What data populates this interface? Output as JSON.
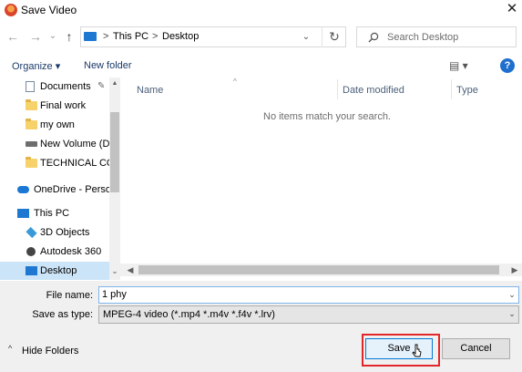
{
  "window": {
    "title": "Save Video",
    "close_glyph": "✕"
  },
  "nav_buttons": {
    "back_glyph": "←",
    "forward_glyph": "→",
    "dropdown_glyph": "⌄",
    "up_glyph": "↑"
  },
  "address": {
    "segments": [
      "This PC",
      "Desktop"
    ],
    "separator": ">",
    "dropdown_glyph": "⌄",
    "refresh_glyph": "↻"
  },
  "search": {
    "placeholder": "Search Desktop"
  },
  "toolbar": {
    "organize_label": "Organize ▾",
    "new_folder_label": "New folder",
    "view_glyph": "▤ ▾",
    "help_glyph": "?"
  },
  "navpane": {
    "items": [
      {
        "label": "Documents",
        "icon": "documents-icon",
        "pinned": true
      },
      {
        "label": "Final work",
        "icon": "folder-icon"
      },
      {
        "label": "my own",
        "icon": "folder-icon"
      },
      {
        "label": "New Volume (D:",
        "icon": "drive-icon"
      },
      {
        "label": "TECHNICAL CON",
        "icon": "folder-icon"
      },
      {
        "label": "OneDrive - Person",
        "icon": "onedrive-icon"
      },
      {
        "label": "This PC",
        "icon": "this-pc-icon"
      },
      {
        "label": "3D Objects",
        "icon": "3d-objects-icon"
      },
      {
        "label": "Autodesk 360",
        "icon": "autodesk-icon"
      },
      {
        "label": "Desktop",
        "icon": "desktop-icon",
        "selected": true
      }
    ],
    "pin_glyph": "📌",
    "expand_glyph": "⌄"
  },
  "filelist": {
    "columns": [
      "Name",
      "Date modified",
      "Type"
    ],
    "sort_glyph": "^",
    "empty_message": "No items match your search."
  },
  "form": {
    "file_name_label": "File name:",
    "file_name_value": "1 phy",
    "save_as_type_label": "Save as type:",
    "save_as_type_value": "MPEG-4 video (*.mp4 *.m4v *.f4v *.lrv)",
    "dropdown_glyph": "⌄"
  },
  "footer": {
    "hide_folders_label": "Hide Folders",
    "hide_glyph": "^",
    "save_label": "Save",
    "cancel_label": "Cancel"
  },
  "colors": {
    "accent": "#0078d7",
    "highlight_box": "#e3262a",
    "selected_nav": "#cce4f7",
    "panel_bg": "#f0f0f0"
  }
}
